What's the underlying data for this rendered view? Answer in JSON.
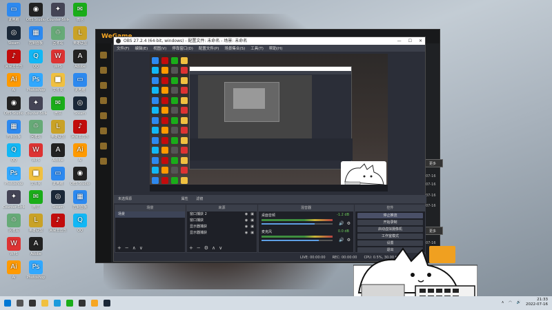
{
  "desktop": {
    "icons": [
      {
        "label": "此电脑",
        "color": "#2d89ef",
        "glyph": "▭"
      },
      {
        "label": "OBS Studio",
        "color": "#222",
        "glyph": "◉"
      },
      {
        "label": "Counter-Strike",
        "color": "#445",
        "glyph": "✦"
      },
      {
        "label": "微信",
        "color": "#1aad19",
        "glyph": "✉"
      },
      {
        "label": "Steam",
        "color": "#1b2838",
        "glyph": "◎"
      },
      {
        "label": "控制面板",
        "color": "#2d89ef",
        "glyph": "▦"
      },
      {
        "label": "回收站",
        "color": "#6a7",
        "glyph": "♲"
      },
      {
        "label": "英雄联盟",
        "color": "#c9a227",
        "glyph": "L"
      },
      {
        "label": "网易云音乐",
        "color": "#c20c0c",
        "glyph": "♪"
      },
      {
        "label": "QQ",
        "color": "#12b7f5",
        "glyph": "Q"
      },
      {
        "label": "WPS",
        "color": "#d33",
        "glyph": "W"
      },
      {
        "label": "Adobe",
        "color": "#222",
        "glyph": "A"
      },
      {
        "label": "Ai",
        "color": "#ff9a00",
        "glyph": "Ai"
      },
      {
        "label": "Photoshop",
        "color": "#31a8ff",
        "glyph": "Ps"
      },
      {
        "label": "文件夹",
        "color": "#f0c040",
        "glyph": "■"
      }
    ]
  },
  "wegame": {
    "logo": "WeGame",
    "dates": [
      "07-16",
      "07-16",
      "07-16",
      "07-16",
      "07-16"
    ],
    "btn_more": "更多",
    "btn_detail": "更多"
  },
  "obs": {
    "title": "OBS 27.2.4 (64-bit, windows) - 配置文件: 未命名 - 场景: 未命名",
    "menu": [
      "文件(F)",
      "编辑(E)",
      "视图(V)",
      "停靠窗口(D)",
      "配置文件(P)",
      "场景集合(S)",
      "工具(T)",
      "帮助(H)"
    ],
    "scene_bar": "未选择源",
    "scene_bar_props": "属性",
    "scene_bar_filters": "滤镜",
    "panels": {
      "scenes": {
        "title": "场景",
        "items": [
          "场景"
        ]
      },
      "sources": {
        "title": "来源",
        "items": [
          "窗口捕获 2",
          "窗口捕获",
          "显示器捕获",
          "显示器捕获"
        ]
      },
      "mixer": {
        "title": "混音器",
        "tracks": [
          {
            "name": "桌面音频",
            "db": "-1.2 dB",
            "level": 0.75
          },
          {
            "name": "麦克风",
            "db": "0.0 dB",
            "level": 0.8
          }
        ]
      },
      "controls": {
        "title": "控件",
        "buttons": [
          "停止推流",
          "开始录制",
          "启动虚拟摄像机",
          "工作室模式",
          "设置",
          "退出"
        ]
      }
    },
    "status": {
      "live": "LIVE: 00:00:00",
      "rec": "REC: 00:00:00",
      "cpu": "CPU: 0.5%, 30.00 fps"
    }
  },
  "taskbar": {
    "apps": [
      "开始",
      "搜索",
      "任务视图",
      "文件资源管理器",
      "Edge",
      "微信",
      "OBS",
      "WeGame",
      "Steam"
    ],
    "time": "21:33",
    "date": "2022-07-16"
  }
}
